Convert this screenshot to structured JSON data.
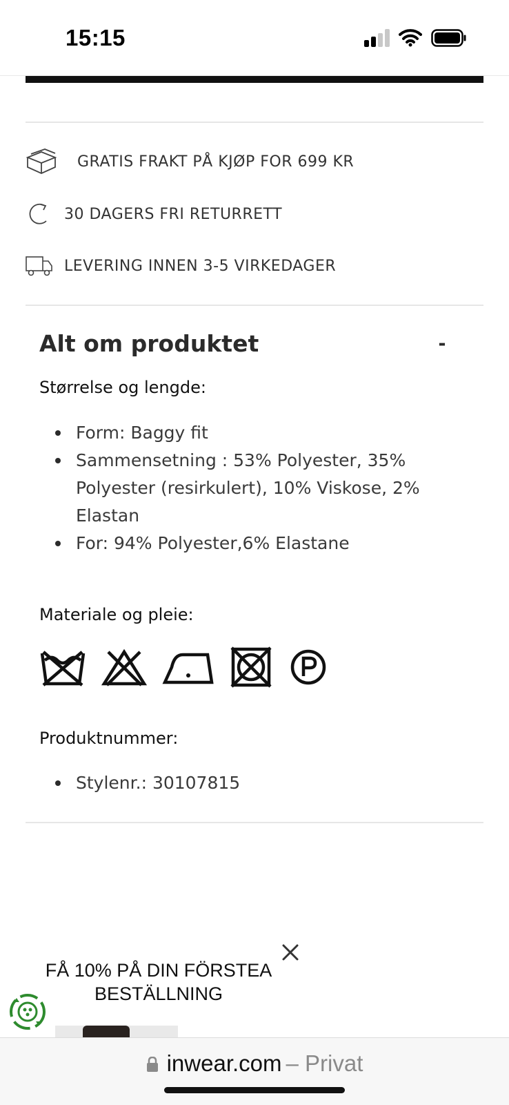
{
  "status_bar": {
    "time": "15:15",
    "signal_icon": "cellular-signal-icon",
    "wifi_icon": "wifi-icon",
    "battery_icon": "battery-icon"
  },
  "usps": [
    {
      "icon": "package-box-icon",
      "text": "GRATIS FRAKT PÅ KJØP FOR 699 KR"
    },
    {
      "icon": "return-arrow-icon",
      "text": "30 DAGERS FRI RETURRETT"
    },
    {
      "icon": "delivery-truck-icon",
      "text": "LEVERING INNEN 3-5 VIRKEDAGER"
    }
  ],
  "accordion": {
    "title": "Alt om produktet",
    "toggle": "-"
  },
  "size_section": {
    "heading": "Størrelse og lengde:",
    "bullets": [
      "Form: Baggy fit",
      "Sammensetning : 53% Polyester, 35% Polyester (resirkulert), 10% Viskose, 2% Elastan",
      "For: 94% Polyester,6% Elastane"
    ]
  },
  "care_section": {
    "heading": "Materiale og pleie:",
    "icons": [
      "do-not-wash-icon",
      "do-not-bleach-icon",
      "iron-low-heat-icon",
      "do-not-tumble-dry-icon",
      "professional-dry-clean-p-icon"
    ]
  },
  "product_number_section": {
    "heading": "Produktnummer:",
    "bullets": [
      "Stylenr.: 30107815"
    ]
  },
  "popup": {
    "text": "FÅ 10% PÅ DIN FÖRSTEA BESTÄLLNING",
    "close_icon": "close-icon",
    "badge_icon": "recycle-badge-icon"
  },
  "browser": {
    "lock_icon": "lock-icon",
    "domain": "inwear.com",
    "separator": "–",
    "mode": "Privat"
  },
  "colors": {
    "text": "#2b2b2b",
    "divider": "#e6e6e6",
    "badge_green": "#2e8b2e",
    "url_gray": "#8a8a8a"
  }
}
